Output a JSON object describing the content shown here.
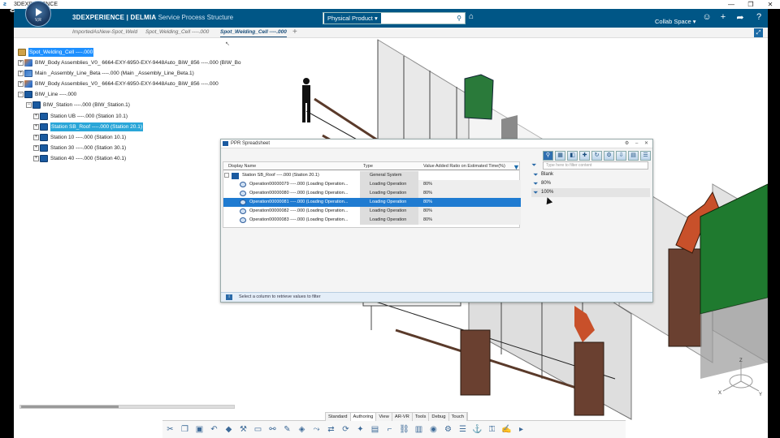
{
  "os": {
    "title": "3DEXPERIENCE",
    "controls": [
      "—",
      "❐",
      "✕"
    ]
  },
  "header": {
    "brand": "3DEXPERIENCE | DELMIA",
    "app": "Service Process Structure",
    "compass_label": "V,R",
    "search_scope": "Physical Product ▾",
    "search_placeholder": "",
    "collab_space": "Collab Space ▾"
  },
  "tabs": [
    {
      "label": "ImportedAsNew-Spot_Weld",
      "active": false
    },
    {
      "label": "Spot_Welding_Cell ----.000",
      "active": false
    },
    {
      "label": "Spot_Welding_Cell ----.000",
      "active": true
    }
  ],
  "tree": {
    "nodes": [
      {
        "label": "Spot_Welding_Cell ----.000",
        "state": "selected"
      },
      {
        "label": "BIW_Body Assemblies_V0_ 6664-EXY-6950-EXY-9448Auto_BiW_856 ----.000 (BIW_Bo",
        "state": ""
      },
      {
        "label": "Main _Assembly_Line_Beta ----.000 (Main _Assembly_Line_Beta.1)",
        "state": ""
      },
      {
        "label": "BIW_Body Assemblies_V0_ 6664-EXY-6950-EXY-9448Auto_BiW_856 ----.000",
        "state": ""
      },
      {
        "label": "BIW_Line ----.000",
        "state": ""
      },
      {
        "label": "BIW_Station ----.000 (BIW_Station.1)",
        "state": ""
      },
      {
        "label": "Station UB ----.000 (Station 10.1)",
        "state": ""
      },
      {
        "label": "Station SB_Roof ----.000 (Station 20.1)",
        "state": "highlighted"
      },
      {
        "label": "Station 10 ----.000 (Station 10.1)",
        "state": ""
      },
      {
        "label": "Station 30 ----.000 (Station 30.1)",
        "state": ""
      },
      {
        "label": "Station 40 ----.000 (Station 40.1)",
        "state": ""
      }
    ]
  },
  "ppr": {
    "title": "PPR Spreadsheet",
    "columns": [
      "Display Name",
      "Type",
      "Value Added Ratio on Estimated Time(%)"
    ],
    "rows": [
      {
        "name": "Station SB_Roof ----.000 (Station 20.1)",
        "type": "General System",
        "value": "",
        "kind": "system",
        "selected": false
      },
      {
        "name": "Operation00000079 ----.000 (Loading Operation...",
        "type": "Loading Operation",
        "value": "80%",
        "kind": "op",
        "selected": false
      },
      {
        "name": "Operation00000080 ----.000 (Loading Operation...",
        "type": "Loading Operation",
        "value": "80%",
        "kind": "op",
        "selected": false
      },
      {
        "name": "Operation00000081 ----.000 (Loading Operation...",
        "type": "Loading Operation",
        "value": "80%",
        "kind": "op",
        "selected": true
      },
      {
        "name": "Operation00000082 ----.000 (Loading Operation...",
        "type": "Loading Operation",
        "value": "80%",
        "kind": "op",
        "selected": false
      },
      {
        "name": "Operation00000083 ----.000 (Loading Operation...",
        "type": "Loading Operation",
        "value": "80%",
        "kind": "op",
        "selected": false
      }
    ],
    "filter_placeholder": "Type here to filter content",
    "filter_options": [
      "Blank",
      "80%",
      "100%"
    ],
    "status": "Select a column to retrieve values to filter"
  },
  "action_bar": {
    "tabs": [
      "Standard",
      "Authoring",
      "View",
      "AR-VR",
      "Tools",
      "Debug",
      "Touch"
    ],
    "active_tab": "Authoring"
  },
  "axes": {
    "labels": [
      "Z",
      "X",
      "Y"
    ]
  },
  "colors": {
    "header_bg": "#005686",
    "selection": "#1f7bd1",
    "highlight": "#2aa6d8"
  }
}
